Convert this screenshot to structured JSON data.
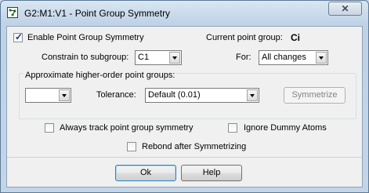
{
  "window": {
    "title": "G2:M1:V1 - Point Group Symmetry",
    "close_glyph": "✕"
  },
  "enable_symmetry": {
    "label": "Enable Point Group Symmetry",
    "checked": true
  },
  "current_point_group": {
    "label": "Current point group:",
    "value": "Ci"
  },
  "constrain": {
    "label": "Constrain to subgroup:",
    "value": "C1"
  },
  "for": {
    "label": "For:",
    "value": "All changes"
  },
  "approximate": {
    "label": "Approximate higher-order point groups:",
    "group_value": "",
    "tolerance_label": "Tolerance:",
    "tolerance_value": "Default (0.01)",
    "symmetrize_label": "Symmetrize"
  },
  "options": {
    "track_label": "Always track point group symmetry",
    "ignore_dummy_label": "Ignore Dummy Atoms",
    "rebond_label": "Rebond after Symmetrizing"
  },
  "buttons": {
    "ok_label": "Ok",
    "help_label": "Help"
  }
}
